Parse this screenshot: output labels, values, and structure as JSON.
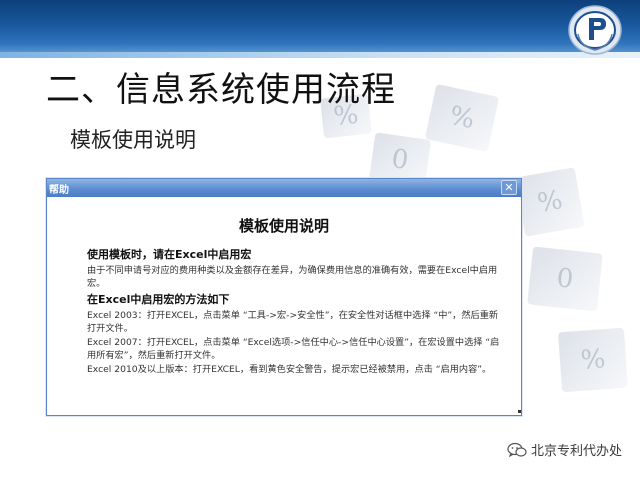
{
  "slide": {
    "title": "二、信息系统使用流程",
    "subtitle": "模板使用说明"
  },
  "dialog": {
    "titlebar": "帮助",
    "close_label": "✕",
    "heading": "模板使用说明",
    "sections": [
      {
        "heading": "使用模板时，请在Excel中启用宏",
        "paragraphs": [
          "由于不同申请号对应的费用种类以及金额存在差异，为确保费用信息的准确有效，需要在Excel中启用宏。"
        ]
      },
      {
        "heading": "在Excel中启用宏的方法如下",
        "paragraphs": [
          "Excel 2003：打开EXCEL，点击菜单 “工具->宏->安全性”，在安全性对话框中选择 “中”，然后重新打开文件。",
          "Excel 2007：打开EXCEL，点击菜单 “Excel选项->信任中心->信任中心设置”，在宏设置中选择 “启用所有宏”，然后重新打开文件。",
          "Excel 2010及以上版本：打开EXCEL，看到黄色安全警告，提示宏已经被禁用，点击 “启用内容”。"
        ]
      }
    ]
  },
  "footer": {
    "brand": "北京专利代办处",
    "icon": "wechat-icon"
  },
  "decor": {
    "cube_glyphs": [
      "%",
      "0",
      "%",
      "%",
      "0",
      "%"
    ]
  },
  "colors": {
    "header_dark": "#0d3f7a",
    "header_light": "#6fa7d8",
    "dialog_titlebar": "#5a8bd0"
  }
}
